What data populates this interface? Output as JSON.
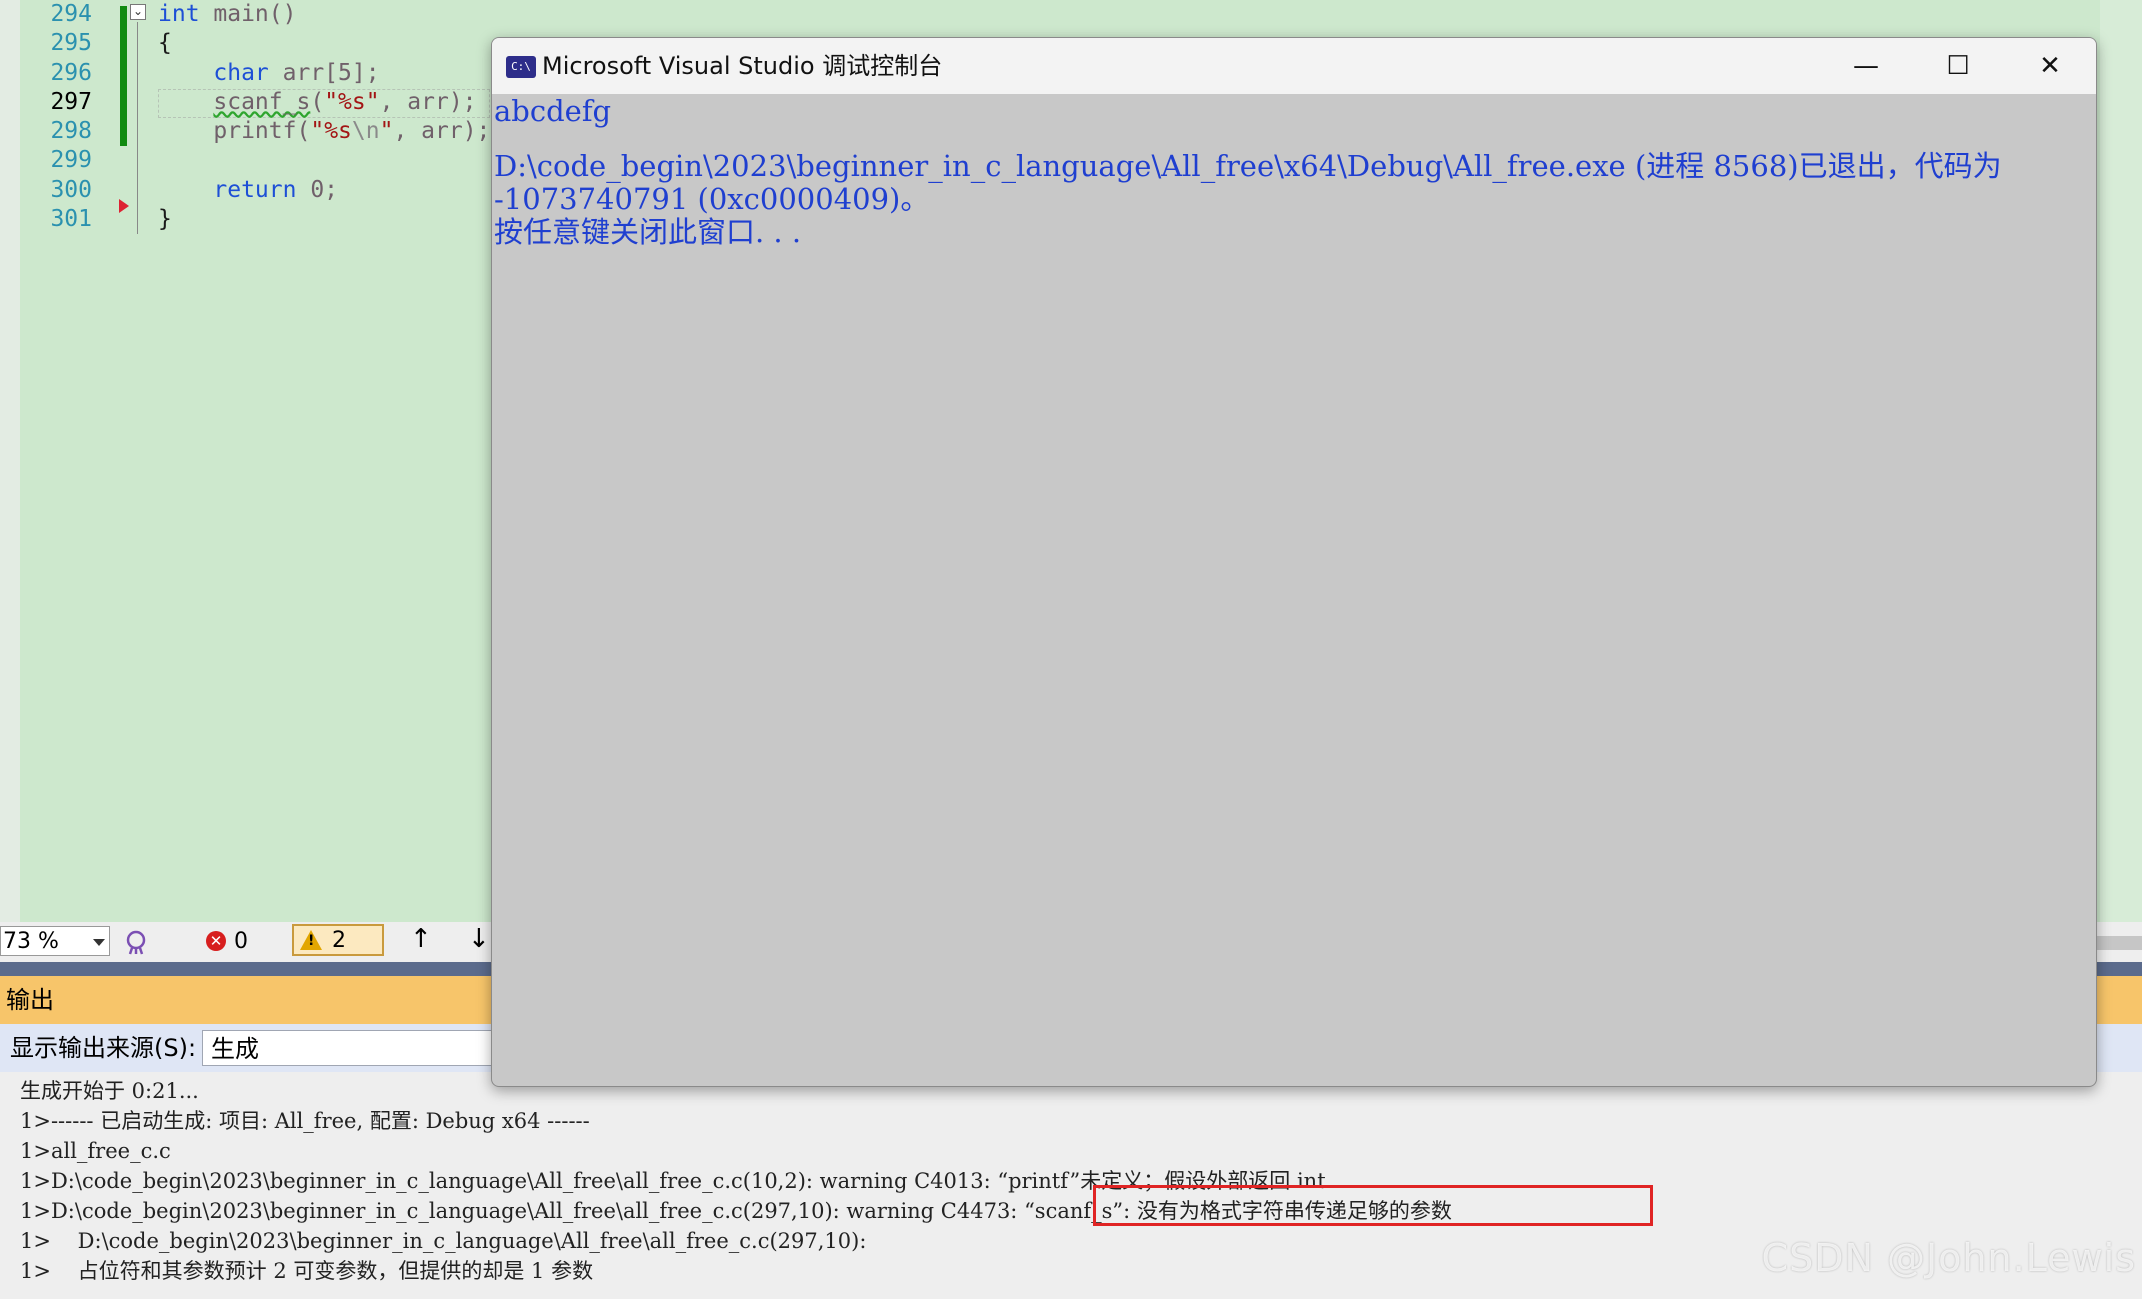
{
  "editor": {
    "line_numbers": [
      "294",
      "295",
      "296",
      "297",
      "298",
      "299",
      "300",
      "301"
    ],
    "code": {
      "l294_kw": "int",
      "l294_rest": " main()",
      "l295": "{",
      "l296_kw": "char",
      "l296_rest": " arr[5];",
      "l297_fn": "scanf_s",
      "l297_open": "(",
      "l297_str": "\"%s\"",
      "l297_rest": ", arr);",
      "l298_fn": "printf",
      "l298_open": "(",
      "l298_str1": "\"%s",
      "l298_esc": "\\n",
      "l298_str2": "\"",
      "l298_rest": ", arr);",
      "l300_kw": "return",
      "l300_rest": " 0;",
      "l301": "}"
    },
    "collapse_glyph": "⌄"
  },
  "statusbar": {
    "zoom": "73 %",
    "error_count": "0",
    "warning_count": "2",
    "error_glyph": "✕",
    "warning_glyph": "!",
    "nav_up": "↑",
    "nav_down": "↓"
  },
  "output": {
    "header": "输出",
    "source_label": "显示输出来源(S):",
    "source_value": "生成",
    "lines": [
      "生成开始于 0:21...",
      "1>------ 已启动生成: 项目: All_free, 配置: Debug x64 ------",
      "1>all_free_c.c",
      "1>D:\\code_begin\\2023\\beginner_in_c_language\\All_free\\all_free_c.c(10,2): warning C4013: “printf”未定义；假设外部返回 int",
      "1>D:\\code_begin\\2023\\beginner_in_c_language\\All_free\\all_free_c.c(297,10): warning C4473: “scanf_s”: 没有为格式字符串传递足够的参数",
      "1>    D:\\code_begin\\2023\\beginner_in_c_language\\All_free\\all_free_c.c(297,10):",
      "1>    占位符和其参数预计 2 可变参数，但提供的却是 1 参数"
    ]
  },
  "console": {
    "icon_label": "C:\\",
    "title": "Microsoft Visual Studio 调试控制台",
    "minimize": "—",
    "maximize": "☐",
    "close": "✕",
    "lines": [
      "abcdefg",
      "",
      "D:\\code_begin\\2023\\beginner_in_c_language\\All_free\\x64\\Debug\\All_free.exe (进程 8568)已退出，代码为",
      "-1073740791 (0xc0000409)。",
      "按任意键关闭此窗口. . ."
    ]
  },
  "watermark": "CSDN @John.Lewis"
}
